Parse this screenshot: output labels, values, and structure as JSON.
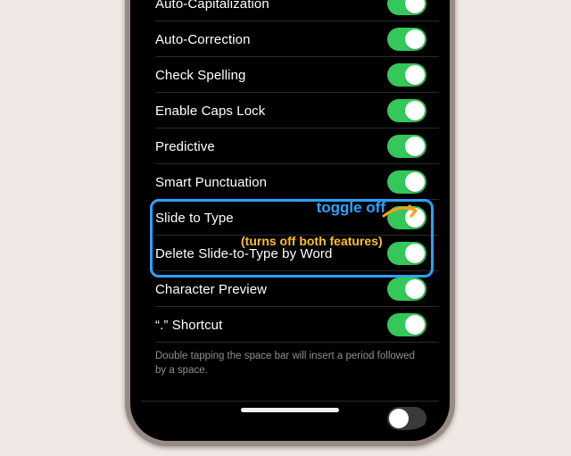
{
  "settings": {
    "rows": [
      {
        "label": "Auto-Capitalization",
        "on": true
      },
      {
        "label": "Auto-Correction",
        "on": true
      },
      {
        "label": "Check Spelling",
        "on": true
      },
      {
        "label": "Enable Caps Lock",
        "on": true
      },
      {
        "label": "Predictive",
        "on": true
      },
      {
        "label": "Smart Punctuation",
        "on": true
      },
      {
        "label": "Slide to Type",
        "on": true
      },
      {
        "label": "Delete Slide-to-Type by Word",
        "on": true
      },
      {
        "label": "Character Preview",
        "on": true
      },
      {
        "label": "“.” Shortcut",
        "on": true
      }
    ],
    "footer": "Double tapping the space bar will insert a period followed by a space.",
    "partial_last": ""
  },
  "annotation": {
    "title": "toggle off",
    "subtitle": "(turns off both features)"
  }
}
